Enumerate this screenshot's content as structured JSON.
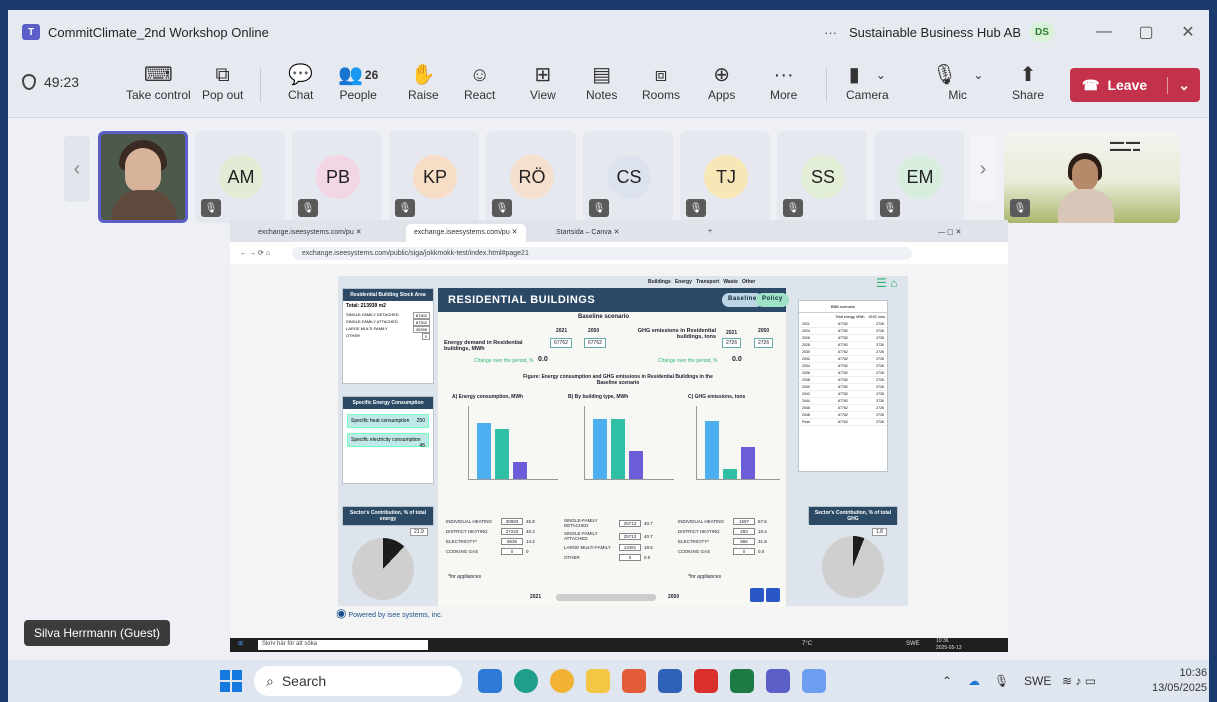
{
  "window": {
    "title": "CommitClimate_2nd Workshop Online",
    "more_dots": "···",
    "org": "Sustainable Business Hub AB",
    "user_initials": "DS",
    "minimize": "—",
    "restore": "▢",
    "close": "✕"
  },
  "toolbar": {
    "timer": "49:23",
    "items": [
      {
        "label": "Take control",
        "icon": "⌨"
      },
      {
        "label": "Pop out",
        "icon": "⧉"
      },
      {
        "label": "Chat",
        "icon": "💬"
      },
      {
        "label": "People",
        "icon": "👥",
        "count": "26"
      },
      {
        "label": "Raise",
        "icon": "✋"
      },
      {
        "label": "React",
        "icon": "☺"
      },
      {
        "label": "View",
        "icon": "⊞"
      },
      {
        "label": "Notes",
        "icon": "▤"
      },
      {
        "label": "Rooms",
        "icon": "⧈"
      },
      {
        "label": "Apps",
        "icon": "⊕"
      },
      {
        "label": "More",
        "icon": "···"
      },
      {
        "label": "Camera",
        "icon": "▮"
      },
      {
        "label": "Mic",
        "icon": "🎙"
      },
      {
        "label": "Share",
        "icon": "⬆"
      }
    ],
    "leave_label": "Leave"
  },
  "participants": [
    {
      "initials": "AM",
      "color": "#e4ebd4"
    },
    {
      "initials": "PB",
      "color": "#f3d6e6"
    },
    {
      "initials": "KP",
      "color": "#f7dcc6"
    },
    {
      "initials": "RÖ",
      "color": "#f5e0cd"
    },
    {
      "initials": "CS",
      "color": "#dde3ee"
    },
    {
      "initials": "TJ",
      "color": "#f7e7b7"
    },
    {
      "initials": "SS",
      "color": "#e3eed7"
    },
    {
      "initials": "EM",
      "color": "#d7eedf"
    }
  ],
  "speaker_name": "Silva Herrmann (Guest)",
  "browser": {
    "tabs": [
      "exchange.iseesystems.com/pu",
      "exchange.iseesystems.com/pu",
      "Startsida – Canva"
    ],
    "url": "exchange.iseesystems.com/public/siga/jokkmokk-test/index.html#page21"
  },
  "model_page": {
    "nav": [
      "Buildings",
      "Energy",
      "Transport",
      "Waste",
      "Other"
    ],
    "title": "RESIDENTIAL BUILDINGS",
    "btn_baseline": "Baseline",
    "btn_policy": "Policy",
    "scenario": "Baseline scenario",
    "energy_label": "Energy demand in Residential buildings, MWh",
    "years": [
      "2021",
      "2050"
    ],
    "energy_2021": "67762",
    "energy_2050": "67762",
    "ghg_label": "GHG emissions in Residential buildings, tons",
    "ghg_2021": "2726",
    "ghg_2050": "2726",
    "change_label": "Change over the period, %",
    "change_energy": "0.0",
    "change_ghg": "0.0",
    "figure_title": "Figure: Energy consumption and GHG emissions in Residential Buildings in the Baseline scenario",
    "chart_a": "A) Energy consumption, MWh",
    "chart_b": "B) By building type, MWh",
    "chart_c": "C) GHG emissions, tons",
    "stock_title": "Residential Building Stock Area",
    "stock_total_label": "Total:",
    "stock_total": "213939",
    "stock_unit": "m2",
    "stock_rows": [
      {
        "label": "SINGLE-FAMILY DETACHED",
        "value": "87302"
      },
      {
        "label": "SINGLE-FAMILY ATTACHED",
        "value": "87302"
      },
      {
        "label": "LARGE MULTI-FAMILY",
        "value": "39395"
      },
      {
        "label": "OTHER",
        "value": "0"
      }
    ],
    "specific_title": "Specific Energy Consumption",
    "specific_heat_label": "Specific heat consumption",
    "specific_heat": "250",
    "specific_el_label": "Specific electricity consumption",
    "specific_el": "45",
    "sector_title": "Sector's Contribution, % of total energy",
    "sector_value": "21.9",
    "sector_ghg_title": "Sector's Contribution, % of total GHG",
    "sector_ghg_value": "1.8",
    "year_start": "2021",
    "year_end": "2050",
    "powered": "Powered by isee systems, inc.",
    "table_header": "BBB scenario",
    "table_cols": [
      "Total energy, MWh",
      "GHG, tons"
    ],
    "table_rows": [
      [
        "2021",
        "67762",
        "2726"
      ],
      [
        "2024",
        "67762",
        "2726"
      ],
      [
        "2026",
        "67762",
        "2726"
      ],
      [
        "2028",
        "67762",
        "2726"
      ],
      [
        "2030",
        "67762",
        "2726"
      ],
      [
        "2032",
        "67762",
        "2726"
      ],
      [
        "2034",
        "67762",
        "2726"
      ],
      [
        "2036",
        "67762",
        "2726"
      ],
      [
        "2038",
        "67762",
        "2726"
      ],
      [
        "2040",
        "67762",
        "2726"
      ],
      [
        "2042",
        "67762",
        "2726"
      ],
      [
        "2044",
        "67762",
        "2726"
      ],
      [
        "2046",
        "67762",
        "2726"
      ],
      [
        "2048",
        "67762",
        "2726"
      ],
      [
        "Final",
        "67762",
        "2726"
      ]
    ],
    "bottom_rows_a": [
      {
        "label": "INDIVIDUAL HEATING",
        "value": "30983",
        "pct": "45.8"
      },
      {
        "label": "DISTRICT HEATING",
        "value": "27232",
        "pct": "40.2"
      },
      {
        "label": "ELECTRICITY*",
        "value": "9636",
        "pct": "14.2"
      },
      {
        "label": "COOKING GAS",
        "value": "0",
        "pct": "0"
      }
    ],
    "bottom_rows_b": [
      {
        "label": "SINGLE-FAMILY DETACHED",
        "value": "25713",
        "pct": "40.7"
      },
      {
        "label": "SINGLE-FAMILY ATTACHED",
        "value": "25713",
        "pct": "40.7"
      },
      {
        "label": "LARGE MULTI-FAMILY",
        "value": "13481",
        "pct": "19.5"
      },
      {
        "label": "OTHER",
        "value": "0",
        "pct": "0.0"
      }
    ],
    "bottom_rows_c": [
      {
        "label": "INDIVIDUAL HEATING",
        "value": "1597",
        "pct": "57.6"
      },
      {
        "label": "DISTRICT HEATING",
        "value": "283",
        "pct": "10.4"
      },
      {
        "label": "ELECTRICITY*",
        "value": "866",
        "pct": "31.8"
      },
      {
        "label": "COOKING GAS",
        "value": "0",
        "pct": "0.0"
      }
    ],
    "footnote": "*for appliances"
  },
  "remote_taskbar": {
    "search": "Skriv här för att söka",
    "weather": "7°C",
    "lang": "SWE",
    "time": "10:36",
    "date": "2025-05-13"
  },
  "taskbar": {
    "search": "Search",
    "lang": "SWE",
    "time": "10:36",
    "date": "13/05/2025"
  }
}
